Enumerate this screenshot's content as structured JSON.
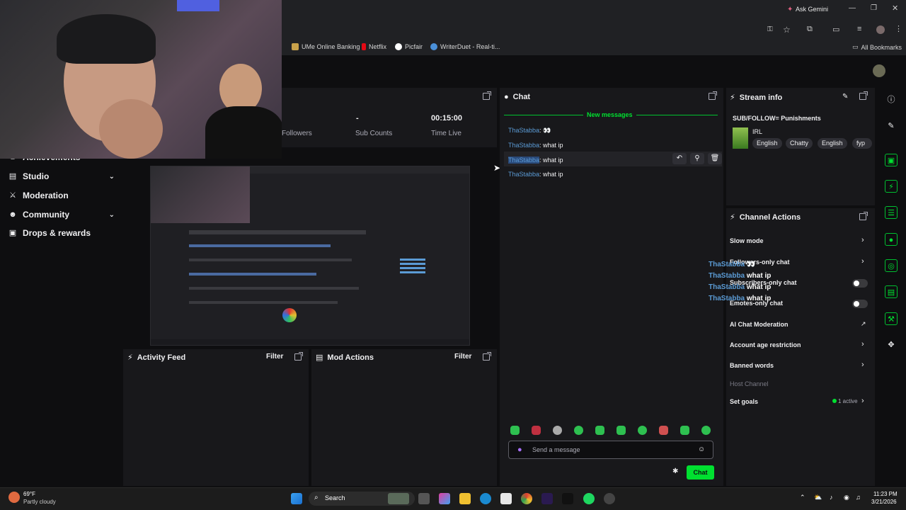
{
  "browser": {
    "ask_gemini": "Ask Gemini",
    "bookmarks": [
      {
        "label": "UMe Online Banking",
        "color": "#c8a14a"
      },
      {
        "label": "Netflix",
        "color": "#e50914"
      },
      {
        "label": "Picfair",
        "color": "#ffffff"
      },
      {
        "label": "WriterDuet - Real-ti...",
        "color": "#4a90d9"
      }
    ],
    "all_bookmarks": "All Bookmarks"
  },
  "sidebar": {
    "items": [
      {
        "label": "Achievements",
        "icon": "trophy-icon",
        "has_chevron": false
      },
      {
        "label": "Studio",
        "icon": "studio-icon",
        "has_chevron": true
      },
      {
        "label": "Moderation",
        "icon": "sword-icon",
        "has_chevron": false
      },
      {
        "label": "Community",
        "icon": "people-icon",
        "has_chevron": true
      },
      {
        "label": "Drops & rewards",
        "icon": "gift-icon",
        "has_chevron": false
      }
    ]
  },
  "stats": {
    "followers_label": "Followers",
    "sub_counts_value": "-",
    "sub_counts_label": "Sub Counts",
    "time_live_value": "00:15:00",
    "time_live_label": "Time Live"
  },
  "activity_feed": {
    "title": "Activity Feed",
    "filter": "Filter"
  },
  "mod_actions": {
    "title": "Mod Actions",
    "filter": "Filter"
  },
  "chat": {
    "title": "Chat",
    "new_messages": "New messages",
    "messages": [
      {
        "user": "ThaStabba",
        "text": ": 👀"
      },
      {
        "user": "ThaStabba",
        "text": ": what ip"
      },
      {
        "user": "ThaStabba",
        "text": ": what ip"
      },
      {
        "user": "ThaStabba",
        "text": ": what ip"
      }
    ],
    "input_placeholder": "Send a message",
    "chat_button": "Chat"
  },
  "stream_info": {
    "title": "Stream info",
    "stream_title": "SUB/FOLLOW= Punishments",
    "category": "IRL",
    "tags": [
      "English",
      "Chatty",
      "English",
      "fyp"
    ]
  },
  "channel_actions": {
    "title": "Channel Actions",
    "items": [
      {
        "label": "Slow mode",
        "control": "chevron"
      },
      {
        "label": "Followers-only chat",
        "control": "chevron"
      },
      {
        "label": "Subscribers-only chat",
        "control": "toggle"
      },
      {
        "label": "Emotes-only chat",
        "control": "toggle"
      },
      {
        "label": "AI Chat Moderation",
        "control": "external"
      },
      {
        "label": "Account age restriction",
        "control": "chevron"
      },
      {
        "label": "Banned words",
        "control": "chevron"
      },
      {
        "label": "Host Channel",
        "control": "none"
      },
      {
        "label": "Set goals",
        "control": "chevron"
      }
    ],
    "goals_status": "1 active",
    "overlay_lines": [
      {
        "user": "ThaStabba",
        "text": "👀"
      },
      {
        "user": "ThaStabba",
        "text": "what ip"
      },
      {
        "user": "ThaStabba",
        "text": "what ip"
      },
      {
        "user": "ThaStabba",
        "text": "what ip"
      }
    ]
  },
  "taskbar": {
    "weather_temp": "69°F",
    "weather_desc": "Partly cloudy",
    "search": "Search",
    "time": "11:23 PM",
    "date": "3/21/2026"
  },
  "colors": {
    "accent_green": "#00e030",
    "username_blue": "#5b9bd5",
    "panel_bg": "#18181b"
  }
}
